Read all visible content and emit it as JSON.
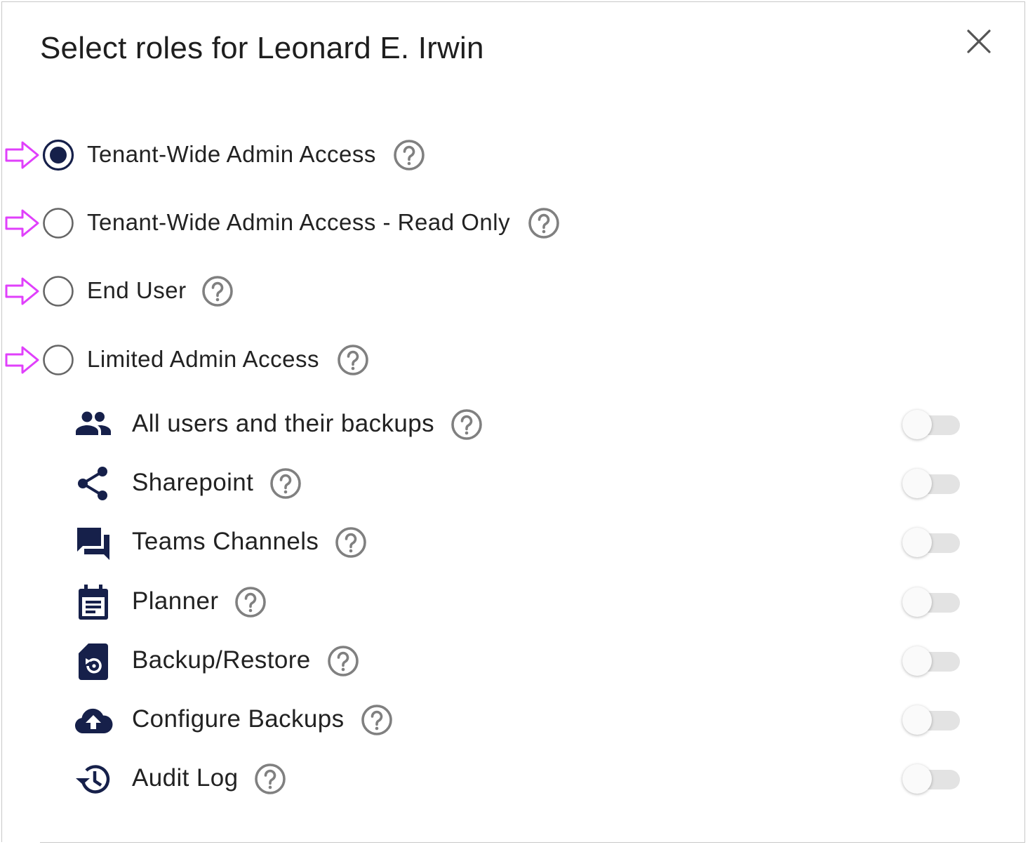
{
  "dialog": {
    "title": "Select roles for Leonard E. Irwin",
    "close_icon": "close-icon"
  },
  "roles": [
    {
      "label": "Tenant-Wide Admin Access",
      "selected": true
    },
    {
      "label": "Tenant-Wide Admin Access - Read Only",
      "selected": false
    },
    {
      "label": "End User",
      "selected": false
    },
    {
      "label": "Limited Admin Access",
      "selected": false
    }
  ],
  "permissions": [
    {
      "label": "All users and their backups",
      "icon": "users-icon",
      "enabled": false
    },
    {
      "label": "Sharepoint",
      "icon": "share-icon",
      "enabled": false
    },
    {
      "label": "Teams Channels",
      "icon": "chat-icon",
      "enabled": false
    },
    {
      "label": "Planner",
      "icon": "calendar-icon",
      "enabled": false
    },
    {
      "label": "Backup/Restore",
      "icon": "file-restore-icon",
      "enabled": false
    },
    {
      "label": "Configure Backups",
      "icon": "cloud-upload-icon",
      "enabled": false
    },
    {
      "label": "Audit Log",
      "icon": "history-icon",
      "enabled": false
    }
  ],
  "colors": {
    "accent": "#16204a",
    "annotation_arrow": "#e040fb",
    "help_icon": "#808080",
    "toggle_track": "#e3e3e3"
  }
}
